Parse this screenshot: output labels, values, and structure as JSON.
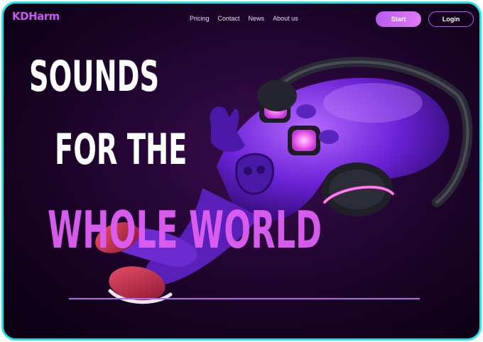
{
  "header": {
    "logo": "KDHarm",
    "nav": [
      "Pricing",
      "Contact",
      "News",
      "About us"
    ],
    "start_label": "Start",
    "login_label": "Login"
  },
  "hero": {
    "line1": "SOUNDS",
    "line2": "FOR THE",
    "line3": "WHOLE WORLD"
  },
  "colors": {
    "accent": "#c55bf0",
    "frame_border": "#1ee6e6",
    "hero_highlight": "#dd5ff2",
    "background": "#1a0326"
  }
}
